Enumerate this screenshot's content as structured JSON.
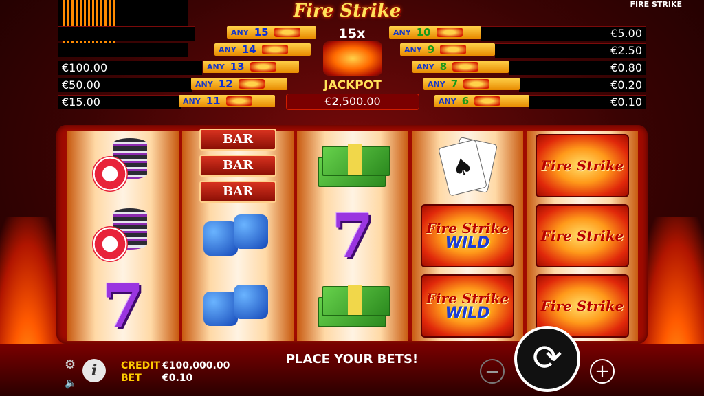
{
  "header": {
    "logo_text": "Fire Strike",
    "game_title": "FIRE STRIKE"
  },
  "paytable": {
    "any_label": "ANY",
    "left_prizes": [
      "€100.00",
      "€50.00",
      "€15.00"
    ],
    "right_prizes": [
      "€5.00",
      "€2.50",
      "€0.80",
      "€0.20",
      "€0.10"
    ],
    "left_counts": [
      "15",
      "14",
      "13",
      "12",
      "11"
    ],
    "right_counts": [
      "10",
      "9",
      "8",
      "7",
      "6"
    ]
  },
  "jackpot": {
    "multiplier": "15x",
    "label": "JACKPOT",
    "value": "€2,500.00"
  },
  "reels": {
    "bar_label": "BAR",
    "fire_strike_text": "Fire Strike",
    "wild_text": "WILD",
    "seven_text": "7"
  },
  "bottom_bar": {
    "credit_label": "CREDIT",
    "credit_value": "€100,000.00",
    "bet_label": "BET",
    "bet_value": "€0.10",
    "status": "PLACE YOUR BETS!",
    "info_label": "i",
    "minus_label": "−",
    "plus_label": "+",
    "spin_icon": "⟳"
  },
  "colors": {
    "accent_yellow": "#ffcc00",
    "fire_red": "#d11d00",
    "wild_blue": "#1b3dd4"
  }
}
